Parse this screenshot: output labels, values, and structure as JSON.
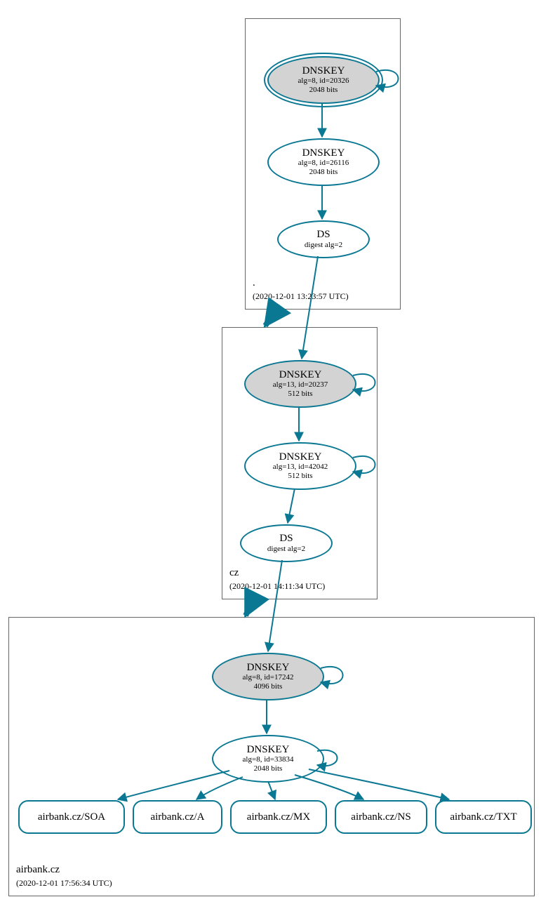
{
  "colors": {
    "stroke": "#0b7893"
  },
  "zones": {
    "root": {
      "label": ".",
      "timestamp": "(2020-12-01 13:23:57 UTC)"
    },
    "cz": {
      "label": "cz",
      "timestamp": "(2020-12-01 14:11:34 UTC)"
    },
    "airbank": {
      "label": "airbank.cz",
      "timestamp": "(2020-12-01 17:56:34 UTC)"
    }
  },
  "nodes": {
    "root_ksk": {
      "title": "DNSKEY",
      "sub1": "alg=8, id=20326",
      "sub2": "2048 bits"
    },
    "root_zsk": {
      "title": "DNSKEY",
      "sub1": "alg=8, id=26116",
      "sub2": "2048 bits"
    },
    "root_ds": {
      "title": "DS",
      "sub1": "digest alg=2"
    },
    "cz_ksk": {
      "title": "DNSKEY",
      "sub1": "alg=13, id=20237",
      "sub2": "512 bits"
    },
    "cz_zsk": {
      "title": "DNSKEY",
      "sub1": "alg=13, id=42042",
      "sub2": "512 bits"
    },
    "cz_ds": {
      "title": "DS",
      "sub1": "digest alg=2"
    },
    "ab_ksk": {
      "title": "DNSKEY",
      "sub1": "alg=8, id=17242",
      "sub2": "4096 bits"
    },
    "ab_zsk": {
      "title": "DNSKEY",
      "sub1": "alg=8, id=33834",
      "sub2": "2048 bits"
    },
    "rr_soa": {
      "label": "airbank.cz/SOA"
    },
    "rr_a": {
      "label": "airbank.cz/A"
    },
    "rr_mx": {
      "label": "airbank.cz/MX"
    },
    "rr_ns": {
      "label": "airbank.cz/NS"
    },
    "rr_txt": {
      "label": "airbank.cz/TXT"
    }
  }
}
